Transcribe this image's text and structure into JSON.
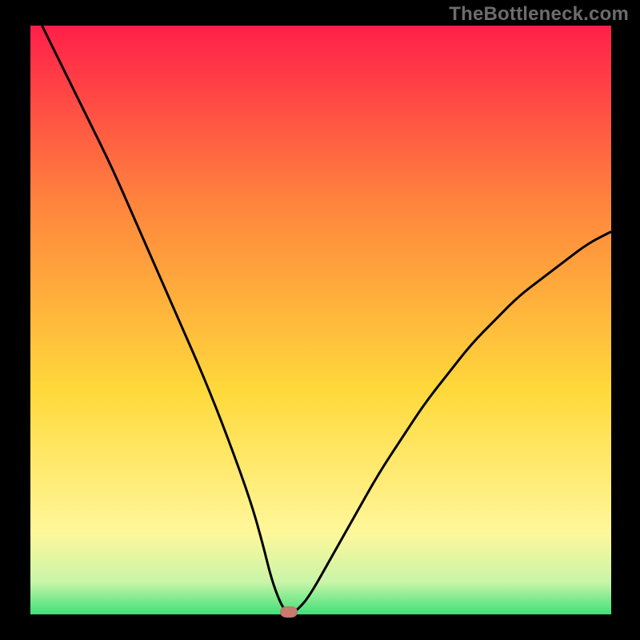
{
  "watermark": "TheBottleneck.com",
  "colors": {
    "bg": "#000000",
    "grad_top": "#ff1f49",
    "grad_upper_mid": "#ff843d",
    "grad_mid": "#ffd93b",
    "grad_lower": "#fff79a",
    "grad_green_light": "#c9f5a8",
    "grad_green": "#3fe07a",
    "curve": "#000000",
    "marker": "#c87a6f"
  },
  "chart_data": {
    "type": "line",
    "title": "",
    "xlabel": "",
    "ylabel": "",
    "xlim": [
      0,
      100
    ],
    "ylim": [
      0,
      100
    ],
    "series": [
      {
        "name": "bottleneck-curve",
        "x": [
          2,
          6,
          10,
          14,
          18,
          22,
          26,
          30,
          34,
          38,
          40,
          41.5,
          43,
          44,
          45,
          46,
          48,
          52,
          56,
          60,
          64,
          68,
          72,
          76,
          80,
          84,
          88,
          92,
          96,
          100
        ],
        "y": [
          100,
          92,
          84,
          76,
          67,
          58,
          49,
          40,
          30,
          19,
          12,
          6,
          2,
          0.5,
          0.2,
          0.8,
          3,
          10,
          17,
          24,
          30,
          36,
          41,
          46,
          50,
          54,
          57,
          60,
          63,
          65
        ]
      }
    ],
    "marker": {
      "x": 44.5,
      "y": 0.4
    },
    "grid": false,
    "legend": false
  }
}
